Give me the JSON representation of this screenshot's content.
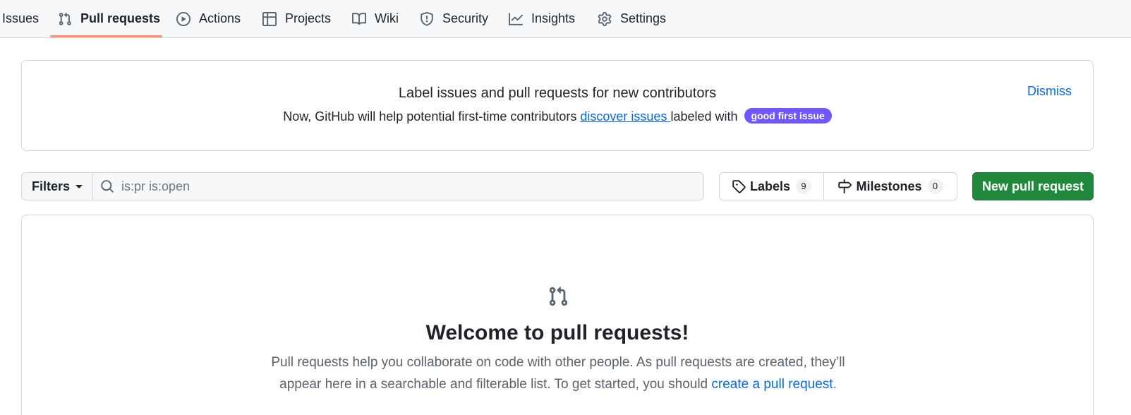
{
  "nav": {
    "items": [
      {
        "label": "Issues",
        "icon": "issue-opened-icon"
      },
      {
        "label": "Pull requests",
        "icon": "git-pull-request-icon",
        "selected": true
      },
      {
        "label": "Actions",
        "icon": "play-icon"
      },
      {
        "label": "Projects",
        "icon": "table-icon"
      },
      {
        "label": "Wiki",
        "icon": "book-icon"
      },
      {
        "label": "Security",
        "icon": "shield-icon"
      },
      {
        "label": "Insights",
        "icon": "graph-icon"
      },
      {
        "label": "Settings",
        "icon": "gear-icon"
      }
    ],
    "accent_color": "#fd8c73"
  },
  "banner": {
    "title": "Label issues and pull requests for new contributors",
    "text_before": "Now, GitHub will help potential first-time contributors ",
    "link": "discover issues ",
    "text_after": "labeled with",
    "label": "good first issue",
    "label_color": "#7057ff",
    "dismiss": "Dismiss"
  },
  "filters": {
    "button": "Filters",
    "search_value": "",
    "search_placeholder": "is:pr is:open"
  },
  "labels": {
    "label": "Labels",
    "count": "9"
  },
  "milestones": {
    "label": "Milestones",
    "count": "0"
  },
  "new_pr": {
    "label": "New pull request",
    "color": "#1f883d"
  },
  "blankslate": {
    "title": "Welcome to pull requests!",
    "text": "Pull requests help you collaborate on code with other people. As pull requests are created, they’ll appear here in a searchable and filterable list. To get started, you should ",
    "link": "create a pull request",
    "text_end": "."
  }
}
